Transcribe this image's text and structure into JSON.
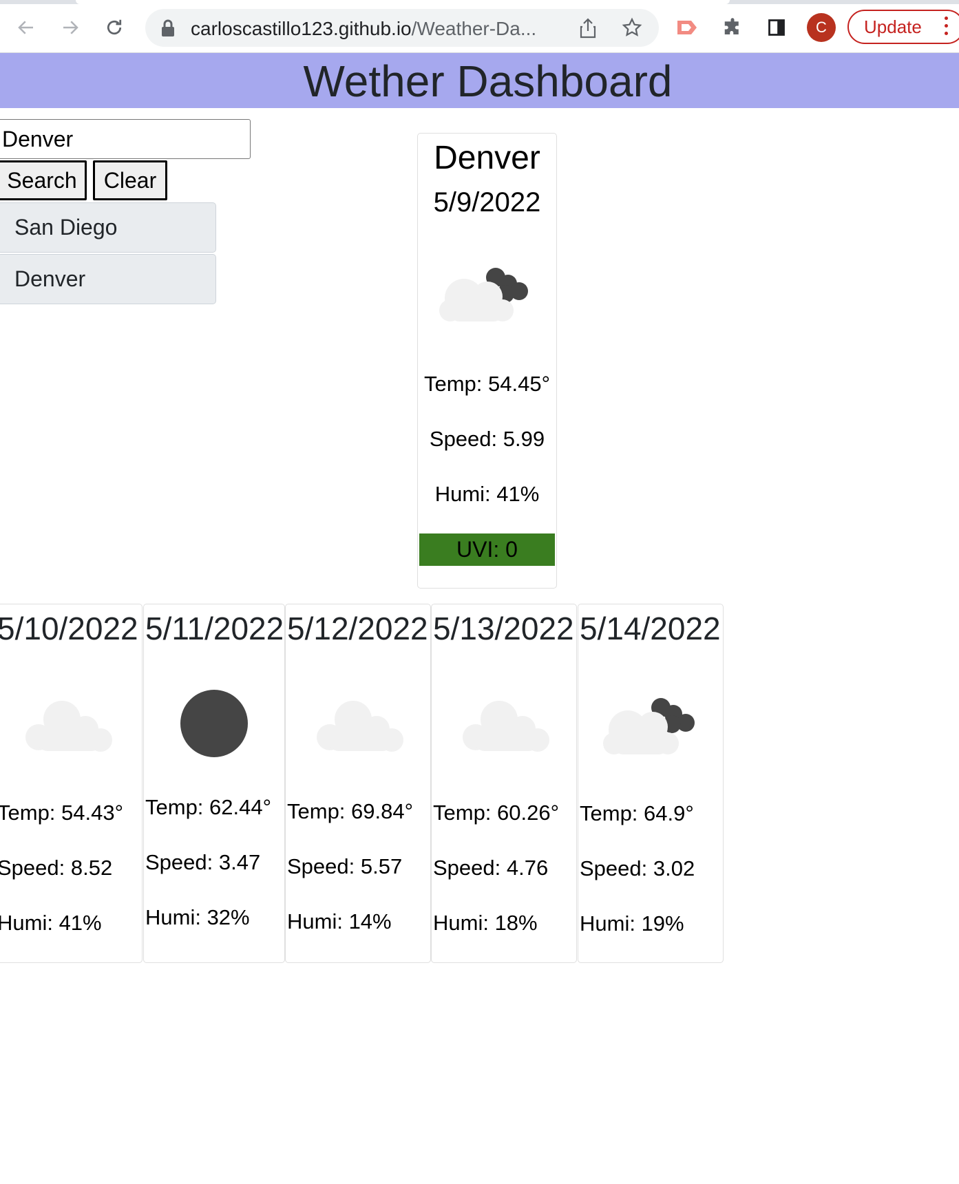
{
  "browser": {
    "url_host": "carloscastillo123.github.io",
    "url_path": "/Weather-Da...",
    "profile_initial": "C",
    "update_label": "Update"
  },
  "header": {
    "title": "Wether Dashboard"
  },
  "search": {
    "value": "Denver",
    "search_label": "Search",
    "clear_label": "Clear",
    "history": [
      "San Diego",
      "Denver"
    ]
  },
  "current": {
    "city": "Denver",
    "date": "5/9/2022",
    "icon": "partly-cloudy-night-icon",
    "temp": "Temp: 54.45°",
    "speed": "Speed: 5.99",
    "humi": "Humi: 41%",
    "uvi": "UVI: 0",
    "uvi_color": "#3a7d20"
  },
  "forecast": [
    {
      "date": "5/10/2022",
      "icon": "cloud-icon",
      "temp": "Temp: 54.43°",
      "speed": "Speed: 8.52",
      "humi": "Humi: 41%"
    },
    {
      "date": "5/11/2022",
      "icon": "moon-icon",
      "temp": "Temp: 62.44°",
      "speed": "Speed: 3.47",
      "humi": "Humi: 32%"
    },
    {
      "date": "5/12/2022",
      "icon": "cloud-icon",
      "temp": "Temp: 69.84°",
      "speed": "Speed: 5.57",
      "humi": "Humi: 14%"
    },
    {
      "date": "5/13/2022",
      "icon": "cloud-icon",
      "temp": "Temp: 60.26°",
      "speed": "Speed: 4.76",
      "humi": "Humi: 18%"
    },
    {
      "date": "5/14/2022",
      "icon": "partly-cloudy-night-icon",
      "temp": "Temp: 64.9°",
      "speed": "Speed: 3.02",
      "humi": "Humi: 19%"
    }
  ],
  "colors": {
    "banner": "#a6a8ee",
    "history_bg": "#e9ecef"
  }
}
